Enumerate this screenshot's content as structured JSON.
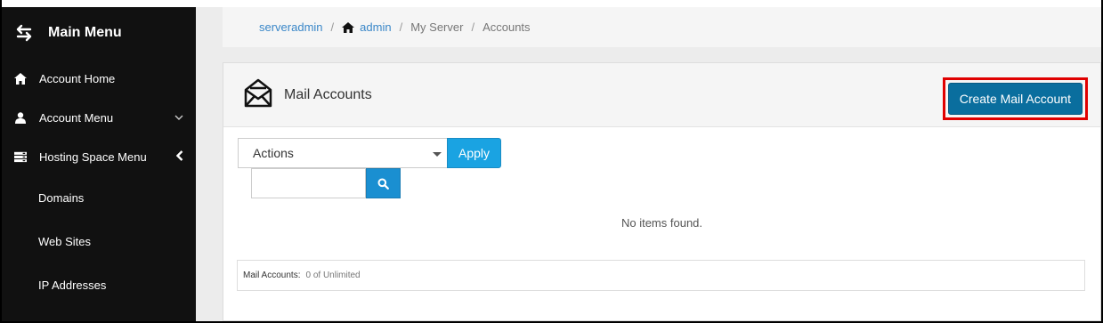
{
  "sidebar": {
    "title": "Main Menu",
    "items": [
      {
        "label": "Account Home",
        "icon": "home-icon"
      },
      {
        "label": "Account Menu",
        "icon": "user-icon"
      },
      {
        "label": "Hosting Space Menu",
        "icon": "server-icon"
      },
      {
        "label": "Domains"
      },
      {
        "label": "Web Sites"
      },
      {
        "label": "IP Addresses"
      }
    ]
  },
  "breadcrumb": {
    "items": [
      "serveradmin",
      "admin",
      "My Server",
      "Accounts"
    ],
    "separator": "/"
  },
  "panel": {
    "title": "Mail Accounts",
    "create_label": "Create Mail Account",
    "actions_selected": "Actions",
    "apply_label": "Apply",
    "search_value": "",
    "empty_text": "No items found.",
    "footer_label": "Mail Accounts:",
    "footer_value": "0 of Unlimited"
  },
  "colors": {
    "sidebar_bg": "#111111",
    "link": "#3a87c8",
    "primary_button": "#0a6e9e",
    "apply_button": "#1aa3e2",
    "highlight_border": "#e00000"
  }
}
